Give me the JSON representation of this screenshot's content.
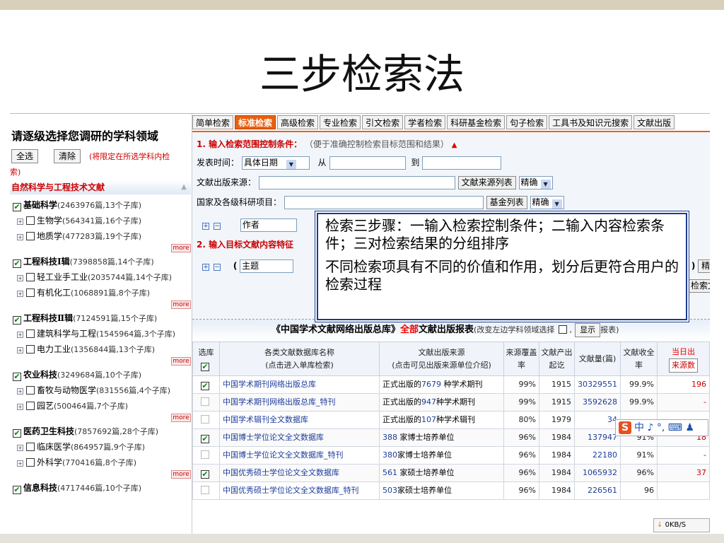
{
  "slide": {
    "title": "三步检索法"
  },
  "left_panel": {
    "title": "请逐级选择您调研的学科领域",
    "select_all": "全选",
    "clear": "清除",
    "hint": "(将限定在所选学科内检",
    "hint_tail": "索)",
    "category": "自然科学与工程技术文献",
    "more_label": "more",
    "items": [
      {
        "name": "基础科学",
        "count": "(2463976篇,13个子库)",
        "checked": "✔",
        "level": "top"
      },
      {
        "name": "生物学",
        "count": "(564341篇,16个子库)",
        "checked": "",
        "level": "sub"
      },
      {
        "name": "地质学",
        "count": "(477283篇,19个子库)",
        "checked": "",
        "level": "sub"
      },
      {
        "name": "工程科技Ⅰ辑",
        "count": "(7398858篇,14个子库)",
        "checked": "✔",
        "level": "top"
      },
      {
        "name": "轻工业手工业",
        "count": "(2035744篇,14个子库)",
        "checked": "",
        "level": "sub"
      },
      {
        "name": "有机化工",
        "count": "(1068891篇,8个子库)",
        "checked": "",
        "level": "sub"
      },
      {
        "name": "工程科技Ⅱ辑",
        "count": "(7124591篇,15个子库)",
        "checked": "✔",
        "level": "top"
      },
      {
        "name": "建筑科学与工程",
        "count": "(1545964篇,3个子库)",
        "checked": "",
        "level": "sub"
      },
      {
        "name": "电力工业",
        "count": "(1356844篇,13个子库)",
        "checked": "",
        "level": "sub"
      },
      {
        "name": "农业科技",
        "count": "(3249684篇,10个子库)",
        "checked": "✔",
        "level": "top"
      },
      {
        "name": "畜牧与动物医学",
        "count": "(831556篇,4个子库)",
        "checked": "",
        "level": "sub"
      },
      {
        "name": "园艺",
        "count": "(500464篇,7个子库)",
        "checked": "",
        "level": "sub"
      },
      {
        "name": "医药卫生科技",
        "count": "(7857692篇,28个子库)",
        "checked": "✔",
        "level": "top"
      },
      {
        "name": "临床医学",
        "count": "(864957篇,9个子库)",
        "checked": "",
        "level": "sub"
      },
      {
        "name": "外科学",
        "count": "(770416篇,8个子库)",
        "checked": "",
        "level": "sub"
      },
      {
        "name": "信息科技",
        "count": "(4717446篇,10个子库)",
        "checked": "✔",
        "level": "top"
      }
    ]
  },
  "tabs": [
    "简单检索",
    "标准检索",
    "高级检索",
    "专业检索",
    "引文检索",
    "学者检索",
    "科研基金检索",
    "句子检索",
    "工具书及知识元搜索",
    "文献出版"
  ],
  "search": {
    "step1": "1. 输入检索范围控制条件：",
    "step1_note": "（便于准确控制检索目标范围和结果）",
    "date_label": "发表时间：",
    "date_mode": "具体日期",
    "from": "从",
    "to": "到",
    "source_label": "文献出版来源：",
    "source_btn": "文献来源列表",
    "exact": "精确",
    "fund_label": "国家及各级科研项目：",
    "fund_btn": "基金列表",
    "author_field": "作者",
    "step2": "2. 输入目标文献内容特征",
    "subject_field": "主题",
    "right_exact": "精确",
    "right_btn": "检索文",
    "plus": "+",
    "minus": "−"
  },
  "note": {
    "p1": "检索三步骤：一输入检索控制条件；二输入内容检索条件；三对检索结果的分组排序",
    "p2": "不同检索项具有不同的价值和作用，划分后更符合用户的检索过程"
  },
  "banner": {
    "pre": "《中国学术文献网络出版总库》",
    "red": "全部",
    "post": "文献出版报表",
    "small": "(改变左边学科领域选择",
    "btn": "显示",
    "tail": "报表)"
  },
  "table": {
    "headers": [
      "选库",
      "各类文献数据库名称\n(点击进入单库检索)",
      "文献出版来源\n(点击可见出版来源单位介绍)",
      "来源覆盖率",
      "文献产出起讫",
      "文献量(篇)",
      "文献收全率",
      "当日出"
    ],
    "sub_hot": "来源数",
    "rows": [
      {
        "chk": "✔",
        "name": "中国学术期刊网络出版总库",
        "src_pre": "正式出版的",
        "src_num": "7679",
        "src_post": " 种学术期刊",
        "cov": "99%",
        "year": "1915",
        "count": "30329551",
        "rate": "99.9%",
        "today": "196"
      },
      {
        "chk": "",
        "name": "中国学术期刊网络出版总库_特刊",
        "src_pre": "正式出版的",
        "src_num": "947",
        "src_post": "种学术期刊",
        "cov": "99%",
        "year": "1915",
        "count": "3592628",
        "rate": "99.9%",
        "today": "-"
      },
      {
        "chk": "",
        "name": "中国学术辑刊全文数据库",
        "src_pre": "正式出版的",
        "src_num": "107",
        "src_post": "种学术辑刊",
        "cov": "80%",
        "year": "1979",
        "count": "34",
        "rate": "",
        "today": ""
      },
      {
        "chk": "✔",
        "name": "中国博士学位论文全文数据库",
        "src_pre": "",
        "src_num": "388",
        "src_post": " 家博士培养单位",
        "cov": "96%",
        "year": "1984",
        "count": "137947",
        "rate": "91%",
        "today": "18"
      },
      {
        "chk": "",
        "name": "中国博士学位论文全文数据库_特刊",
        "src_pre": "",
        "src_num": "380",
        "src_post": "家博士培养单位",
        "cov": "96%",
        "year": "1984",
        "count": "22180",
        "rate": "91%",
        "today": "-"
      },
      {
        "chk": "✔",
        "name": "中国优秀硕士学位论文全文数据库",
        "src_pre": "",
        "src_num": "561",
        "src_post": " 家硕士培养单位",
        "cov": "96%",
        "year": "1984",
        "count": "1065932",
        "rate": "96%",
        "today": "37"
      },
      {
        "chk": "",
        "name": "中国优秀硕士学位论文全文数据库_特刊",
        "src_pre": "",
        "src_num": "503",
        "src_post": "家硕士培养单位",
        "cov": "96%",
        "year": "1984",
        "count": "226561",
        "rate": "96",
        "today": ""
      }
    ]
  },
  "ime": {
    "logo": "S",
    "text": "中 ♪ °, ⌨ ♟"
  },
  "download": {
    "arrow": "↓",
    "rate": "0KB/S"
  },
  "colors": {
    "accent": "#e86010",
    "link": "#1d3c9b",
    "red": "#cc0000",
    "note_border": "#1b3b8f"
  }
}
